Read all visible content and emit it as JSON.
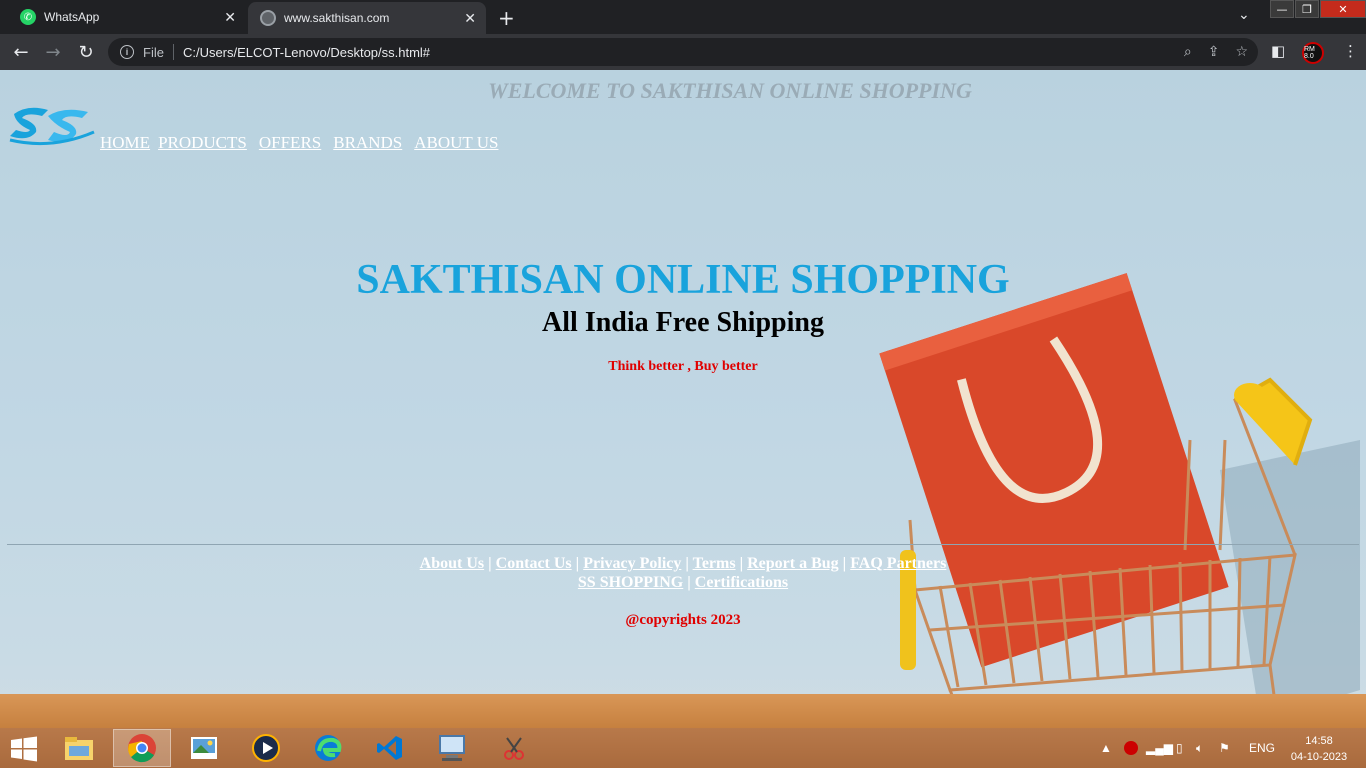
{
  "browser": {
    "tabs": [
      {
        "title": "WhatsApp",
        "icon": "whatsapp-icon"
      },
      {
        "title": "www.sakthisan.com",
        "icon": "globe-icon"
      }
    ],
    "address": {
      "scheme_label": "File",
      "url": "C:/Users/ELCOT-Lenovo/Desktop/ss.html#"
    },
    "profile_badge": "RM 8.0"
  },
  "site": {
    "welcome": "WELCOME TO SAKTHISAN ONLINE SHOPPING",
    "nav": [
      "HOME",
      "PRODUCTS",
      "OFFERS",
      "BRANDS",
      "ABOUT US"
    ],
    "hero_title": "SAKTHISAN ONLINE SHOPPING",
    "hero_subtitle": "All India Free Shipping",
    "tagline": "Think better , Buy better",
    "footer_links": [
      "About Us",
      "Contact Us",
      "Privacy Policy",
      "Terms",
      "Report a Bug",
      "FAQ Partners"
    ],
    "footer_links_line2": [
      "SS SHOPPING",
      "Certifications"
    ],
    "copyright": "@copyrights 2023",
    "colors": {
      "title": "#19a3dc",
      "tagline": "#e00000",
      "nav": "#ffffff"
    }
  },
  "taskbar": {
    "apps": [
      "file-explorer-icon",
      "chrome-icon",
      "photo-viewer-icon",
      "media-player-icon",
      "edge-icon",
      "vscode-icon",
      "remote-desktop-icon",
      "snipping-tool-icon"
    ],
    "language": "ENG",
    "time": "14:58",
    "date": "04-10-2023"
  }
}
